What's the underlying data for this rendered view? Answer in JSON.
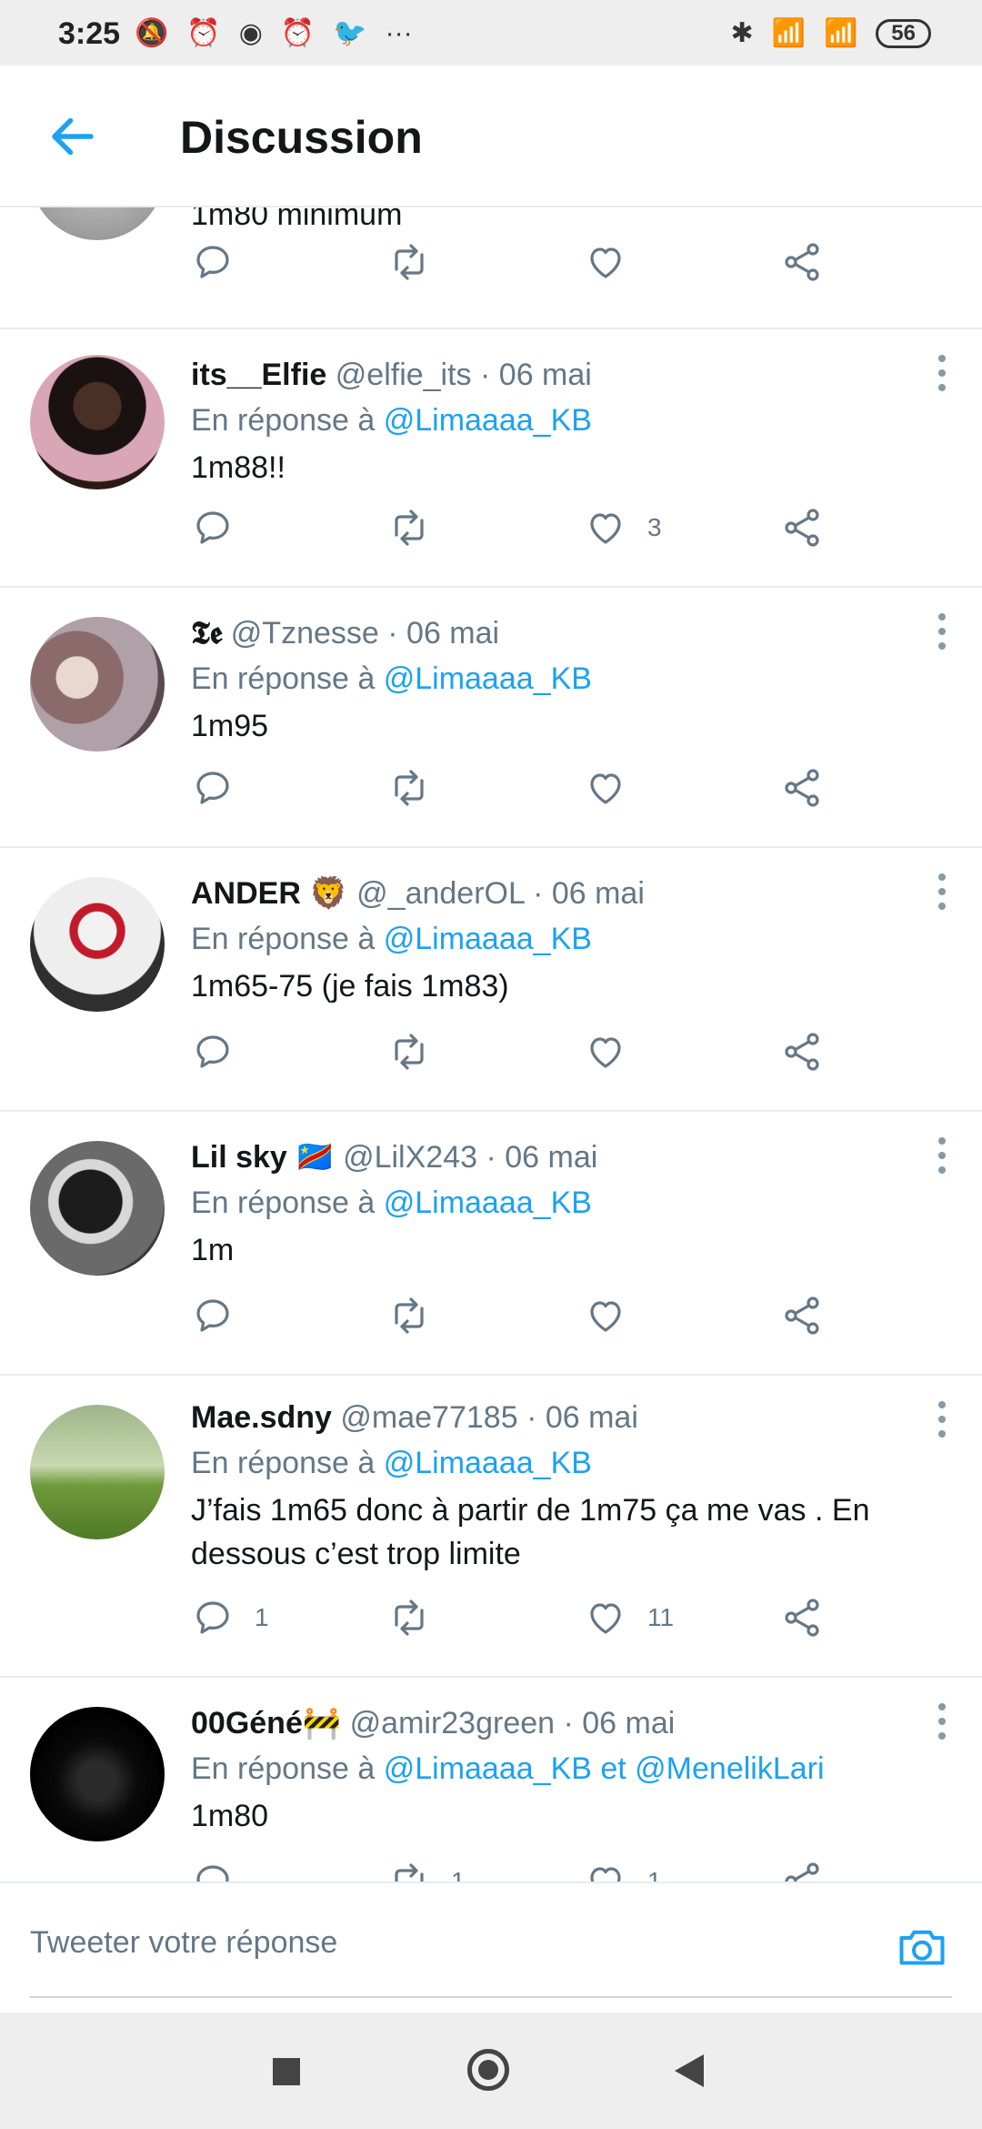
{
  "status_bar": {
    "time": "3:25",
    "battery": "56",
    "left_icons": [
      "🔕",
      "⏰",
      "◉",
      "⏰",
      "🐦",
      "···"
    ],
    "right_icons": [
      "✱",
      "📶",
      "📶"
    ]
  },
  "header": {
    "title": "Discussion"
  },
  "colors": {
    "accent": "#1da1f2",
    "muted": "#657786",
    "divider": "#e6ecf0"
  },
  "partial_tweet": {
    "body": "1m80 minimum"
  },
  "tweets": [
    {
      "name": "its__Elfie",
      "handle": "@elfie_its",
      "date": "· 06 mai",
      "reply_prefix": "En réponse à",
      "mentions": "@Limaaaa_KB",
      "body": "1m88!!",
      "replies": "",
      "retweets": "",
      "likes": "3"
    },
    {
      "name": "𝕿𝖊",
      "handle": "@Tznesse",
      "date": "· 06 mai",
      "reply_prefix": "En réponse à",
      "mentions": "@Limaaaa_KB",
      "body": "1m95",
      "replies": "",
      "retweets": "",
      "likes": ""
    },
    {
      "name": "ANDER 🦁",
      "handle": "@_anderOL",
      "date": "· 06 mai",
      "reply_prefix": "En réponse à",
      "mentions": "@Limaaaa_KB",
      "body": "1m65-75  (je fais 1m83)",
      "replies": "",
      "retweets": "",
      "likes": ""
    },
    {
      "name": "Lil sky 🇨🇩",
      "handle": "@LilX243",
      "date": "· 06 mai",
      "reply_prefix": "En réponse à",
      "mentions": "@Limaaaa_KB",
      "body": "1m",
      "replies": "",
      "retweets": "",
      "likes": ""
    },
    {
      "name": "Mae.sdny",
      "handle": "@mae77185",
      "date": "· 06 mai",
      "reply_prefix": "En réponse à",
      "mentions": "@Limaaaa_KB",
      "body": "J’fais 1m65 donc à partir de 1m75 ça me vas . En dessous c’est trop limite",
      "replies": "1",
      "retweets": "",
      "likes": "11"
    },
    {
      "name": "00Géné🚧",
      "handle": "@amir23green",
      "date": "· 06 mai",
      "reply_prefix": "En réponse à",
      "mentions": "@Limaaaa_KB et @MenelikLari",
      "body": "1m80",
      "replies": "",
      "retweets": "1",
      "likes": "1"
    }
  ],
  "reply_box": {
    "placeholder": "Tweeter votre réponse"
  }
}
